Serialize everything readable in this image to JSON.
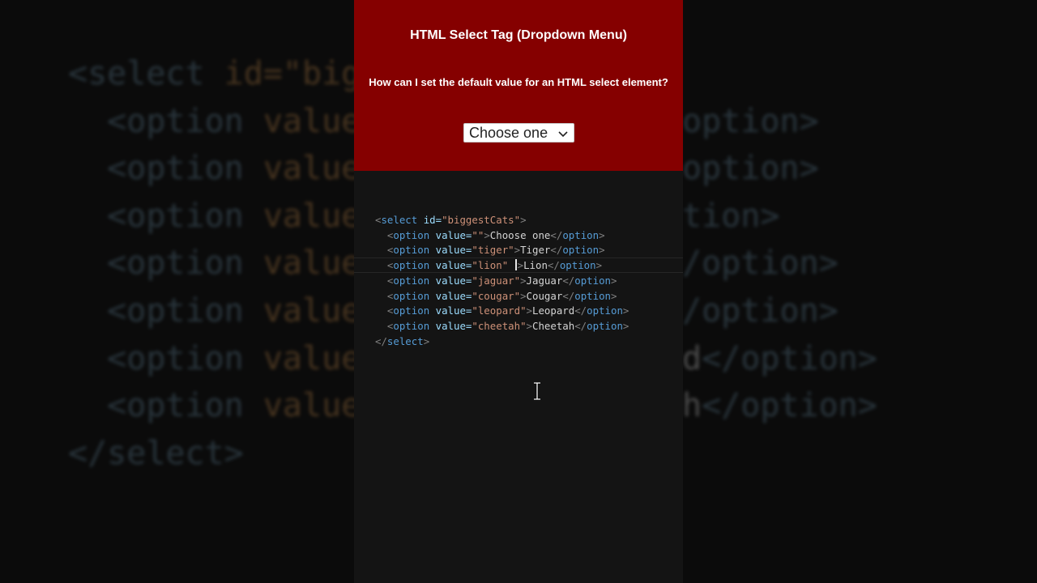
{
  "bg_code": {
    "line1_tag": "<select ",
    "line1_attr": "id=",
    "line1_str": "\"big",
    "option_tag": "<option ",
    "option_attr": "value",
    "end": "</select>"
  },
  "bg_right": {
    "r1": "option>",
    "r2": "option>",
    "r3": "tion>",
    "r4": "/option>",
    "r5": "/option>",
    "r6_letter": "d",
    "r6_tag": "</option>",
    "r7_letter": "h",
    "r7_tag": "</option>"
  },
  "header": {
    "title": "HTML Select Tag (Dropdown Menu)",
    "question": "How can I set the default value for an HTML select element?"
  },
  "select": {
    "value": "Choose one"
  },
  "code": {
    "select_open_tag": "<select ",
    "select_id_attr": "id=",
    "select_id_value": "\"biggestCats\"",
    "select_close": "</select>",
    "options": [
      {
        "value": "\"\"",
        "text": "Choose one"
      },
      {
        "value": "\"tiger\"",
        "text": "Tiger"
      },
      {
        "value": "\"lion\" ",
        "text": "Lion"
      },
      {
        "value": "\"jaguar\"",
        "text": "Jaguar"
      },
      {
        "value": "\"cougar\"",
        "text": "Cougar"
      },
      {
        "value": "\"leopard\"",
        "text": "Leopard"
      },
      {
        "value": "\"cheetah\"",
        "text": "Cheetah"
      }
    ],
    "option_tag": "option",
    "value_attr": "value="
  },
  "colors": {
    "header_bg": "#850000",
    "panel_bg": "#141414",
    "tag": "#569cd6",
    "attr": "#9cdcfe",
    "string": "#ce9178"
  },
  "icons": {
    "dropdown": "chevron-down-icon",
    "cursor": "text-cursor-icon"
  }
}
